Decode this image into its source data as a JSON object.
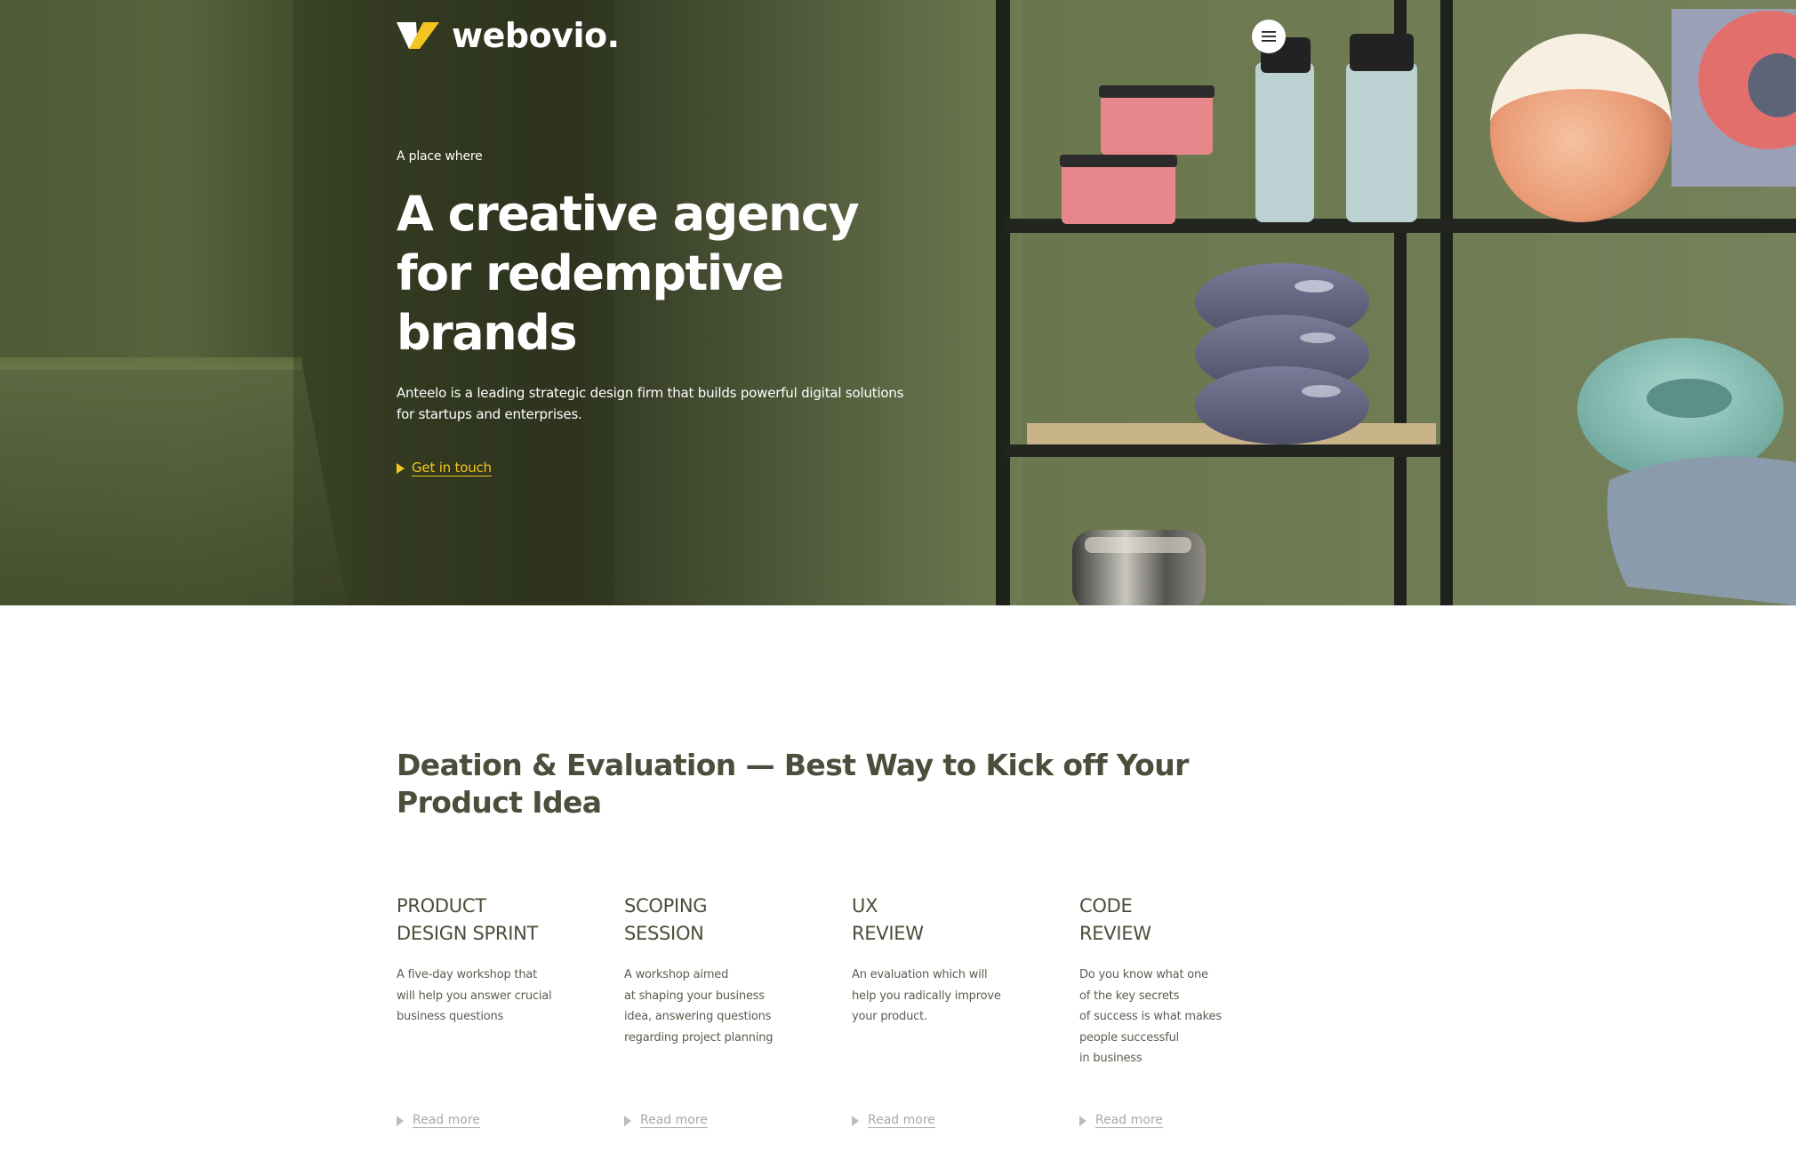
{
  "brand": {
    "name": "webovio.",
    "mark_colors": [
      "#ffffff",
      "#f3c520"
    ]
  },
  "header": {
    "menu_icon": "hamburger-icon"
  },
  "hero": {
    "eyebrow": "A place where",
    "title": "A creative agency for redemptive brands",
    "description": "Anteelo is a leading strategic design firm that builds powerful digital solutions for startups and enterprises.",
    "cta_label": "Get in touch",
    "cta_icon": "play-arrow-icon",
    "accent_color": "#f3c520",
    "background_color": "#6f7b52"
  },
  "services": {
    "title": "Deation & Evaluation — Best Way to Kick off Your Product Idea",
    "cards": [
      {
        "title_lines": [
          "PRODUCT",
          "DESIGN SPRINT"
        ],
        "desc_lines": [
          "A five-day workshop that",
          "will help you answer crucial",
          "business questions"
        ],
        "link": "Read more"
      },
      {
        "title_lines": [
          "SCOPING",
          "SESSION"
        ],
        "desc_lines": [
          "A workshop aimed",
          "at shaping your business",
          "idea, answering questions",
          "regarding project planning"
        ],
        "link": "Read more"
      },
      {
        "title_lines": [
          "UX",
          "REVIEW"
        ],
        "desc_lines": [
          "An evaluation which will",
          "help you radically improve",
          "your product."
        ],
        "link": "Read more"
      },
      {
        "title_lines": [
          "CODE",
          "REVIEW"
        ],
        "desc_lines": [
          "Do you know what one",
          "of the key secrets",
          "of success is what makes",
          "people successful",
          "in business"
        ],
        "link": "Read more"
      }
    ]
  }
}
